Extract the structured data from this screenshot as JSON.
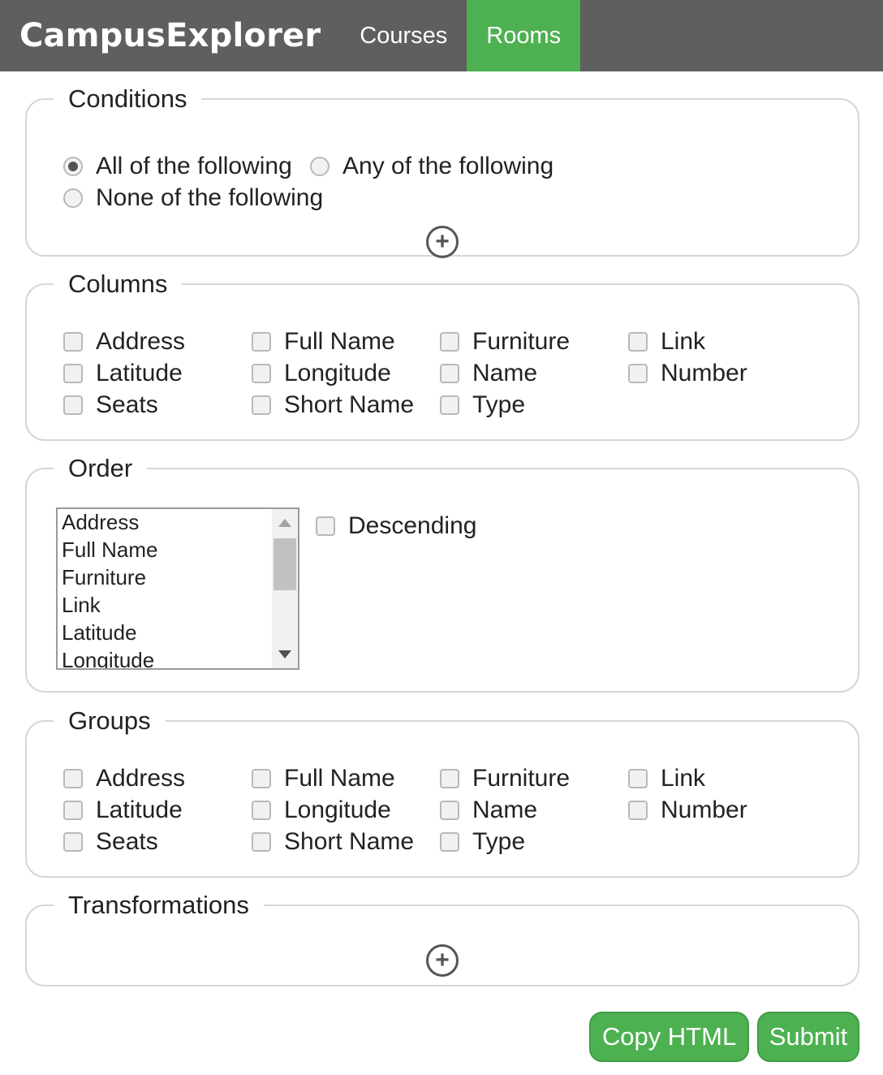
{
  "nav": {
    "brand": "CampusExplorer",
    "tabs": [
      {
        "label": "Courses",
        "active": false
      },
      {
        "label": "Rooms",
        "active": true
      }
    ]
  },
  "conditions": {
    "legend": "Conditions",
    "options": [
      {
        "label": "All of the following",
        "checked": true
      },
      {
        "label": "Any of the following",
        "checked": false
      },
      {
        "label": "None of the following",
        "checked": false
      }
    ],
    "add_icon": "plus-circle-icon"
  },
  "columns": {
    "legend": "Columns",
    "items": [
      "Address",
      "Full Name",
      "Furniture",
      "Link",
      "Latitude",
      "Longitude",
      "Name",
      "Number",
      "Seats",
      "Short Name",
      "Type"
    ]
  },
  "order": {
    "legend": "Order",
    "list": [
      "Address",
      "Full Name",
      "Furniture",
      "Link",
      "Latitude",
      "Longitude"
    ],
    "descending_label": "Descending"
  },
  "groups": {
    "legend": "Groups",
    "items": [
      "Address",
      "Full Name",
      "Furniture",
      "Link",
      "Latitude",
      "Longitude",
      "Name",
      "Number",
      "Seats",
      "Short Name",
      "Type"
    ]
  },
  "transformations": {
    "legend": "Transformations",
    "add_icon": "plus-circle-icon"
  },
  "actions": {
    "copy_html": "Copy HTML",
    "submit": "Submit"
  },
  "colors": {
    "nav_bg": "#5f5f5f",
    "accent": "#4db151"
  }
}
